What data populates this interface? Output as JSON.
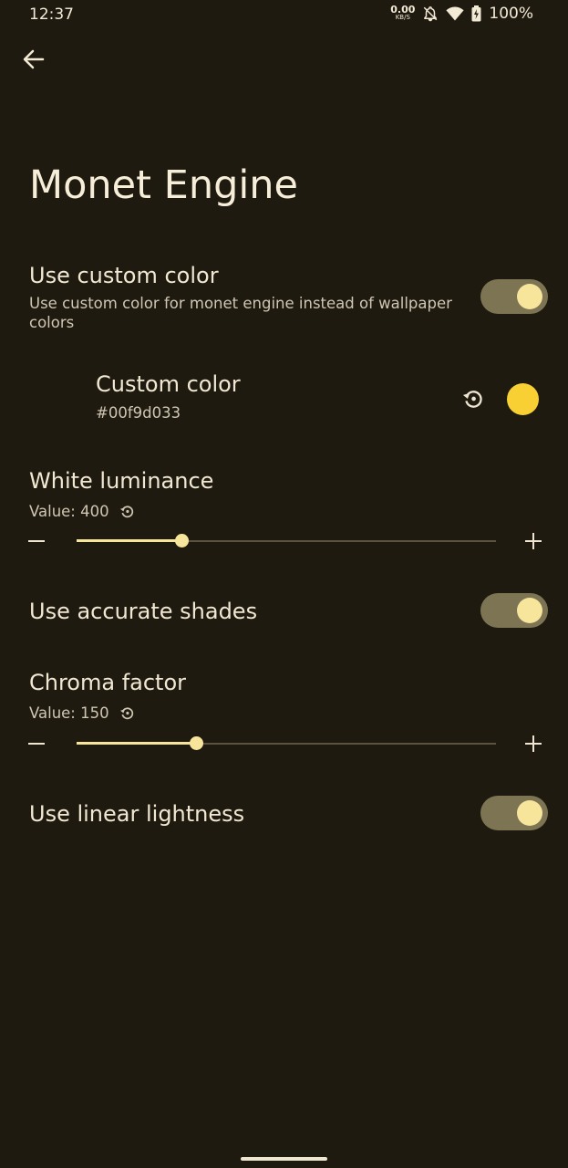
{
  "status_bar": {
    "time": "12:37",
    "net_speed_value": "0.00",
    "net_speed_unit": "KB/S",
    "battery": "100%"
  },
  "page": {
    "title": "Monet Engine"
  },
  "use_custom_color": {
    "title": "Use custom color",
    "summary": "Use custom color for monet engine instead of wallpaper colors",
    "checked": true
  },
  "custom_color": {
    "title": "Custom color",
    "value": "#00f9d033",
    "swatch_color": "#f9d033"
  },
  "white_luminance": {
    "title": "White luminance",
    "value_label": "Value: 400",
    "fraction": 0.25
  },
  "accurate_shades": {
    "title": "Use accurate shades",
    "checked": true
  },
  "chroma_factor": {
    "title": "Chroma factor",
    "value_label": "Value: 150",
    "fraction": 0.285
  },
  "linear_lightness": {
    "title": "Use linear lightness",
    "checked": true
  },
  "colors": {
    "background": "#1f1a0f",
    "accent": "#f7e59c",
    "switch_track": "#7c7453"
  }
}
